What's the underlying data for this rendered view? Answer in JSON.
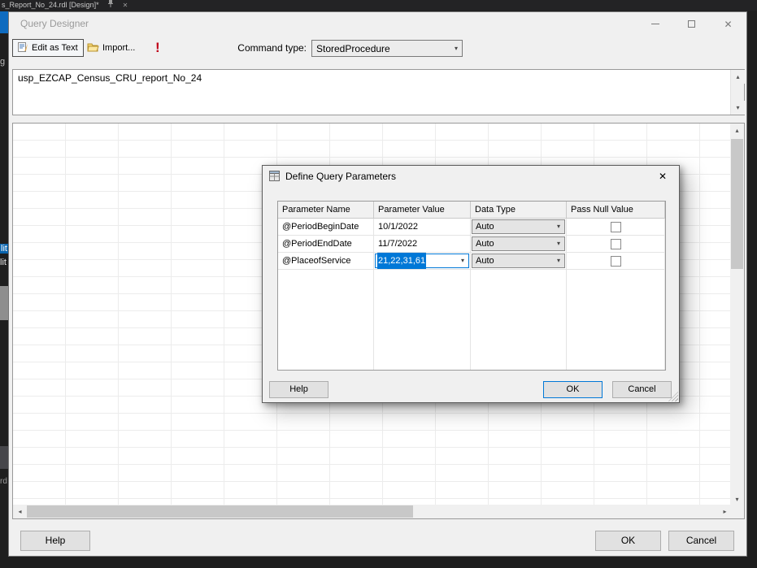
{
  "colors": {
    "accent": "#0078d7",
    "exec_red": "#c00018",
    "selection": "#0078d7"
  },
  "icons": {
    "close": "✕",
    "chevron_down": "▾",
    "scroll_up": "▴",
    "scroll_down": "▾",
    "scroll_left": "◂",
    "scroll_right": "▸",
    "exclamation": "!"
  },
  "ide": {
    "tab_title": "s_Report_No_24.rdl [Design]*",
    "fragments": {
      "f1": "g",
      "f2": "lit",
      "f3": "lit",
      "f4": "rd"
    }
  },
  "query_designer": {
    "title": "Query Designer",
    "toolbar": {
      "edit_as_text_label": "Edit as Text",
      "import_label": "Import...",
      "command_type_label": "Command type:",
      "command_type_value": "StoredProcedure"
    },
    "sql_text": "usp_EZCAP_Census_CRU_report_No_24",
    "buttons": {
      "help": "Help",
      "ok": "OK",
      "cancel": "Cancel"
    }
  },
  "params_dialog": {
    "title": "Define Query Parameters",
    "columns": [
      "Parameter Name",
      "Parameter Value",
      "Data Type",
      "Pass Null Value"
    ],
    "rows": [
      {
        "name": "@PeriodBeginDate",
        "value": "10/1/2022",
        "data_type": "Auto",
        "pass_null_checked": false
      },
      {
        "name": "@PeriodEndDate",
        "value": "11/7/2022",
        "data_type": "Auto",
        "pass_null_checked": false
      },
      {
        "name": "@PlaceofService",
        "value": "21,22,31,61",
        "data_type": "Auto",
        "pass_null_checked": false
      }
    ],
    "buttons": {
      "help": "Help",
      "ok": "OK",
      "cancel": "Cancel"
    }
  }
}
